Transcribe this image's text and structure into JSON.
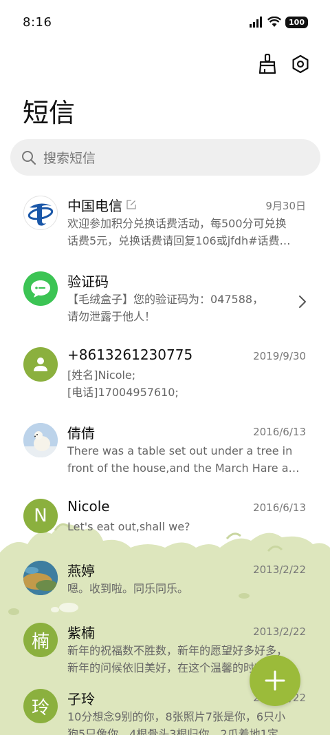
{
  "status": {
    "time": "8:16",
    "battery": "100"
  },
  "title": "短信",
  "search": {
    "placeholder": "搜索短信"
  },
  "conversations": [
    {
      "name": "中国电信",
      "date": "9月30日",
      "line1": "欢迎参加积分兑换话费活动，每500分可兑换",
      "line2": "话费5元，兑换话费请回复106或jfdh#话费…",
      "avatar_icon": "china-telecom-logo"
    },
    {
      "name": "验证码",
      "date": "",
      "line1": "【毛绒盒子】您的验证码为：047588，",
      "line2": "请勿泄露于他人！",
      "avatar_icon": "message-bubble-icon"
    },
    {
      "name": "+8613261230775",
      "date": "2019/9/30",
      "line1": "[姓名]Nicole;",
      "line2": "[电话]17004957610;",
      "avatar_icon": "person-icon"
    },
    {
      "name": "倩倩",
      "date": "2016/6/13",
      "line1": "There was a table set out under a tree in",
      "line2": "front of the house,and the March Hare an…",
      "avatar_icon": "polar-bear-photo"
    },
    {
      "name": "Nicole",
      "date": "2016/6/13",
      "line1": "Let's eat out,shall we?",
      "line2": "",
      "avatar_letter": "N"
    },
    {
      "name": "燕婷",
      "date": "2013/2/22",
      "line1": "嗯。收到啦。同乐同乐。",
      "line2": "",
      "avatar_icon": "landscape-photo"
    },
    {
      "name": "紫楠",
      "date": "2013/2/22",
      "line1": "新年的祝福数不胜数，新年的愿望好多好多，",
      "line2": "新年的问候依旧美好，在这个温馨的时刻…",
      "avatar_letter": "楠"
    },
    {
      "name": "子玲",
      "date": "2013/2/22",
      "line1": "10分想念9别的你，8张照片7张是你，6只小",
      "line2": "狗5只像你，4根骨头3根归你，2爪着地1定…",
      "avatar_letter": "玲"
    }
  ],
  "colors": {
    "accent": "#9bbb3a",
    "green_bg": "#dde6bd",
    "telecom_blue": "#1a57a8",
    "verify_green": "#3cc454"
  }
}
